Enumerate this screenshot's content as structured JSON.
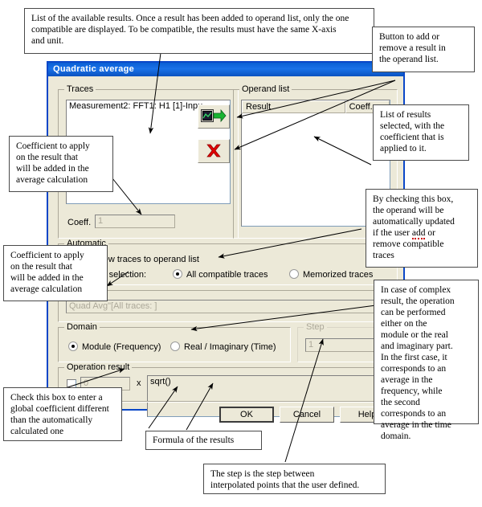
{
  "dialog": {
    "title": "Quadratic average",
    "traces": {
      "group_label": "Traces",
      "items": [
        "Measurement2: FFT1: H1 [1]-Inpu"
      ],
      "coeff_label": "Coeff.",
      "coeff_value": "1"
    },
    "operand_list": {
      "group_label": "Operand list",
      "columns": [
        "Result",
        "Coeff."
      ],
      "rows": []
    },
    "transfer_buttons": {
      "add_icon": "add-to-operand-icon",
      "remove_icon": "remove-red-cross-icon"
    },
    "automatic": {
      "group_label": "Automatic",
      "add_new_traces_label": "Add new traces to operand list",
      "add_new_traces_checked": true,
      "new_trace_selection_label": "New trace selection:",
      "option_all_compatible": "All compatible traces",
      "option_memorized": "Memorized traces",
      "selected_option": "All compatible traces"
    },
    "name": {
      "group_label": "Name",
      "value": "Quad Avg\"[All traces: ]"
    },
    "domain": {
      "group_label": "Domain",
      "option_module": "Module (Frequency)",
      "option_real_imaginary": "Real / Imaginary (Time)",
      "selected_option": "Module (Frequency)"
    },
    "step": {
      "group_label": "Step",
      "value": "1"
    },
    "operation_result": {
      "group_label": "Operation result",
      "checkbox_checked": false,
      "coefficient_value": "0",
      "multiply_symbol": "x",
      "formula": "sqrt()"
    },
    "buttons": {
      "ok": "OK",
      "cancel": "Cancel",
      "help": "Help"
    }
  },
  "annotations": {
    "available_results": {
      "lines": [
        "List of the available results. Once a result has been added to operand list, only the one",
        "compatible are displayed. To be compatible, the results must have the same X-axis",
        "and unit."
      ]
    },
    "add_remove_button": {
      "lines": [
        "Button to add or",
        "remove a result in",
        "the operand list."
      ]
    },
    "coefficient_traces": {
      "lines": [
        "Coefficient to apply",
        "on the result that",
        "will be added in the",
        "average calculation"
      ]
    },
    "coefficient_automatic": {
      "lines": [
        "Coefficient to apply",
        "on the result that",
        "will be added in the",
        "average calculation"
      ]
    },
    "selected_results": {
      "lines": [
        "List of results",
        "selected, with the",
        "coefficient that is",
        "applied to it."
      ]
    },
    "auto_update": {
      "lines_pre": [
        "By checking this box,",
        "the operand will be",
        "automatically updated"
      ],
      "line_with_error_pre": "if the user ",
      "line_error_word": "add",
      "line_with_error_post": " or",
      "lines_post": [
        "remove compatible",
        "traces"
      ]
    },
    "complex_domain": {
      "lines": [
        "In case of complex",
        "result, the operation",
        "can be performed",
        "either on the",
        "module or the real",
        "and imaginary part.",
        "In the first case, it",
        "corresponds to an",
        "average in the",
        "frequency, while",
        "the second",
        "corresponds to an",
        "average in the time",
        "domain."
      ]
    },
    "global_coefficient": {
      "lines": [
        "Check this box to enter a",
        "global coefficient different",
        "than the automatically",
        "calculated one"
      ]
    },
    "formula": {
      "lines": [
        "Formula of the results"
      ]
    },
    "step_note": {
      "lines": [
        "The step is the step between",
        "interpolated points that the user defined."
      ]
    }
  }
}
